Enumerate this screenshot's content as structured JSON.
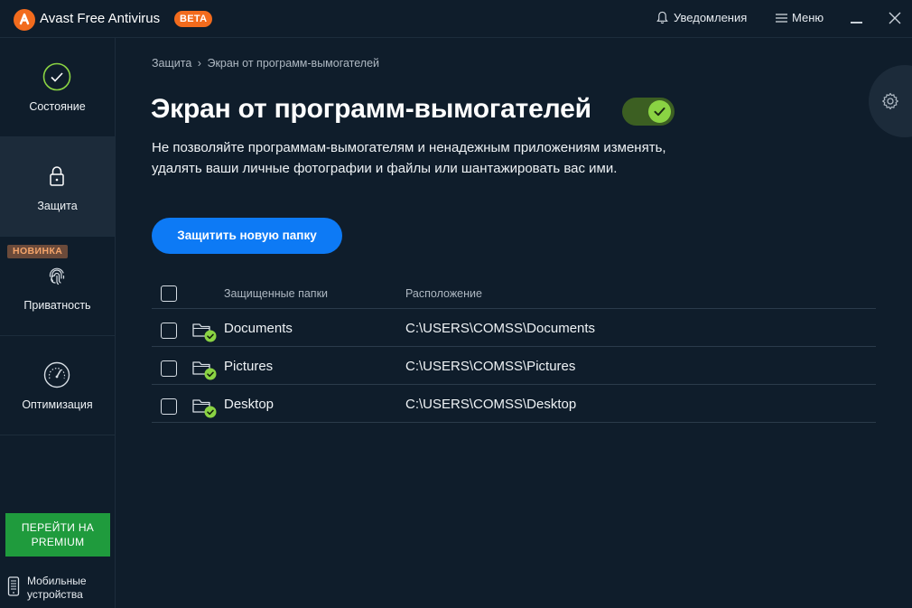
{
  "titlebar": {
    "app_title": "Avast Free Antivirus",
    "beta_badge": "BETA",
    "notifications_label": "Уведомления",
    "menu_label": "Меню"
  },
  "sidebar": {
    "items": [
      {
        "label": "Состояние",
        "icon": "check-circle-icon"
      },
      {
        "label": "Защита",
        "icon": "lock-icon"
      },
      {
        "label": "Приватность",
        "icon": "fingerprint-icon"
      },
      {
        "label": "Оптимизация",
        "icon": "speedometer-icon"
      }
    ],
    "new_badge": "НОВИНКА",
    "premium_button": "ПЕРЕЙТИ НА PREMIUM",
    "mobile_label_1": "Мобильные",
    "mobile_label_2": "устройства"
  },
  "breadcrumb": {
    "parent": "Защита",
    "separator": "›",
    "current": "Экран от программ-вымогателей"
  },
  "main": {
    "title": "Экран от программ-вымогателей",
    "toggle_on": true,
    "description": "Не позволяйте программам-вымогателям и ненадежным приложениям изменять, удалять ваши личные фотографии и файлы или шантажировать вас ими.",
    "protect_button": "Защитить новую папку"
  },
  "table": {
    "headers": {
      "name": "Защищенные папки",
      "location": "Расположение"
    },
    "rows": [
      {
        "name": "Documents",
        "location": "C:\\USERS\\COMSS\\Documents"
      },
      {
        "name": "Pictures",
        "location": "C:\\USERS\\COMSS\\Pictures"
      },
      {
        "name": "Desktop",
        "location": "C:\\USERS\\COMSS\\Desktop"
      }
    ]
  },
  "colors": {
    "background": "#0f1d2b",
    "accent_blue": "#0d7af5",
    "accent_green": "#8ad343",
    "premium_green": "#1f9b3d",
    "brand_orange": "#f26b1d"
  }
}
